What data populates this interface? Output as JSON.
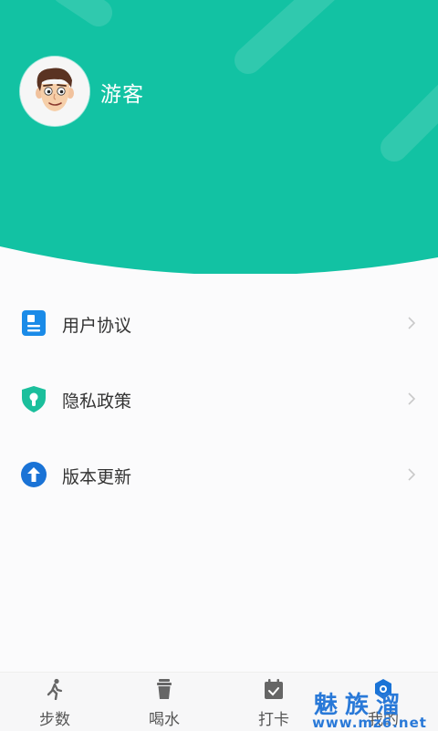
{
  "profile": {
    "username": "游客",
    "avatar_icon": "cartoon-face-avatar"
  },
  "theme": {
    "accent": "#12c2a3",
    "icon_blue": "#1a8be8",
    "icon_teal": "#1bbf9c"
  },
  "menu": {
    "items": [
      {
        "label": "用户协议",
        "icon": "document-icon"
      },
      {
        "label": "隐私政策",
        "icon": "shield-icon"
      },
      {
        "label": "版本更新",
        "icon": "upload-arrow-icon"
      }
    ]
  },
  "tabbar": {
    "tabs": [
      {
        "label": "步数",
        "icon": "walking-icon"
      },
      {
        "label": "喝水",
        "icon": "cup-icon"
      },
      {
        "label": "打卡",
        "icon": "calendar-check-icon"
      },
      {
        "label": "我的",
        "icon": "profile-icon"
      }
    ]
  },
  "watermark": {
    "title": "魅族溜",
    "url": "www.mz6.net"
  }
}
